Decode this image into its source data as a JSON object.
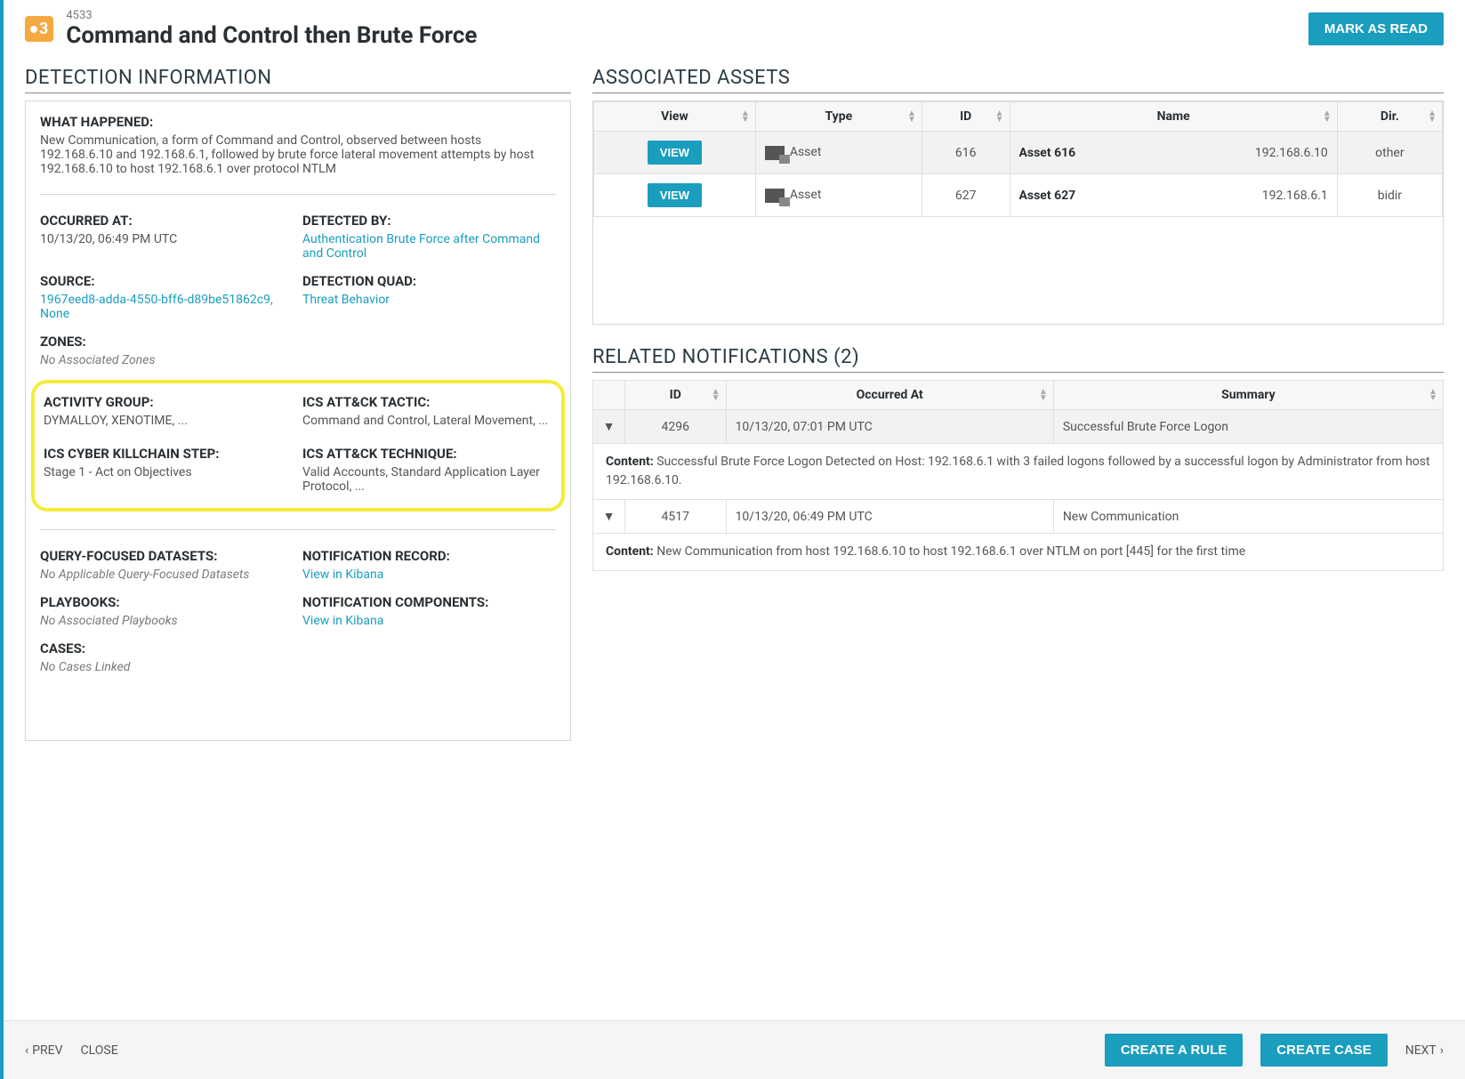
{
  "header": {
    "severity": "3",
    "id": "4533",
    "title": "Command and Control then Brute Force",
    "mark_read": "MARK AS READ"
  },
  "detection": {
    "title": "DETECTION INFORMATION",
    "what_h": "WHAT HAPPENED:",
    "what_t": "New Communication, a form of Command and Control, observed between hosts 192.168.6.10 and 192.168.6.1, followed by brute force lateral movement attempts by host 192.168.6.10 to host 192.168.6.1 over protocol NTLM",
    "occurred_h": "OCCURRED AT:",
    "occurred_t": "10/13/20, 06:49 PM UTC",
    "detected_h": "DETECTED BY:",
    "detected_l": "Authentication Brute Force after Command and Control",
    "source_h": "SOURCE:",
    "source_l": "1967eed8-adda-4550-bff6-d89be51862c9, None",
    "quad_h": "DETECTION QUAD:",
    "quad_l": "Threat Behavior",
    "zones_h": "ZONES:",
    "zones_t": "No Associated Zones",
    "ag_h": "ACTIVITY GROUP:",
    "ag_t": "DYMALLOY, XENOTIME, ...",
    "tactic_h": "ICS ATT&CK TACTIC:",
    "tactic_t": "Command and Control, Lateral Movement, ...",
    "kc_h": "ICS CYBER KILLCHAIN STEP:",
    "kc_t": "Stage 1 - Act on Objectives",
    "tech_h": "ICS ATT&CK TECHNIQUE:",
    "tech_t": "Valid Accounts, Standard Application Layer Protocol, ...",
    "qfd_h": "QUERY-FOCUSED DATASETS:",
    "qfd_t": "No Applicable Query-Focused Datasets",
    "nr_h": "NOTIFICATION RECORD:",
    "nr_l": "View in Kibana",
    "pb_h": "PLAYBOOKS:",
    "pb_t": "No Associated Playbooks",
    "nc_h": "NOTIFICATION COMPONENTS:",
    "nc_l": "View in Kibana",
    "cases_h": "CASES:",
    "cases_t": "No Cases Linked"
  },
  "assets": {
    "title": "ASSOCIATED ASSETS",
    "cols": {
      "view": "View",
      "type": "Type",
      "id": "ID",
      "name": "Name",
      "dir": "Dir."
    },
    "view_btn": "VIEW",
    "rows": [
      {
        "type": "Asset",
        "id": "616",
        "name": "Asset 616",
        "ip": "192.168.6.10",
        "dir": "other"
      },
      {
        "type": "Asset",
        "id": "627",
        "name": "Asset 627",
        "ip": "192.168.6.1",
        "dir": "bidir"
      }
    ]
  },
  "related": {
    "title": "RELATED NOTIFICATIONS (2)",
    "cols": {
      "id": "ID",
      "occurred": "Occurred At",
      "summary": "Summary"
    },
    "content_label": "Content:",
    "rows": [
      {
        "id": "4296",
        "occurred": "10/13/20, 07:01 PM UTC",
        "summary": "Successful Brute Force Logon",
        "content": "Successful Brute Force Logon Detected on Host: 192.168.6.1 with 3 failed logons followed by a successful logon by Administrator from host 192.168.6.10."
      },
      {
        "id": "4517",
        "occurred": "10/13/20, 06:49 PM UTC",
        "summary": "New Communication",
        "content": "New Communication from host 192.168.6.10 to host 192.168.6.1 over NTLM on port [445] for the first time"
      }
    ]
  },
  "footer": {
    "prev": "PREV",
    "close": "CLOSE",
    "create_rule": "CREATE A RULE",
    "create_case": "CREATE CASE",
    "next": "NEXT"
  }
}
